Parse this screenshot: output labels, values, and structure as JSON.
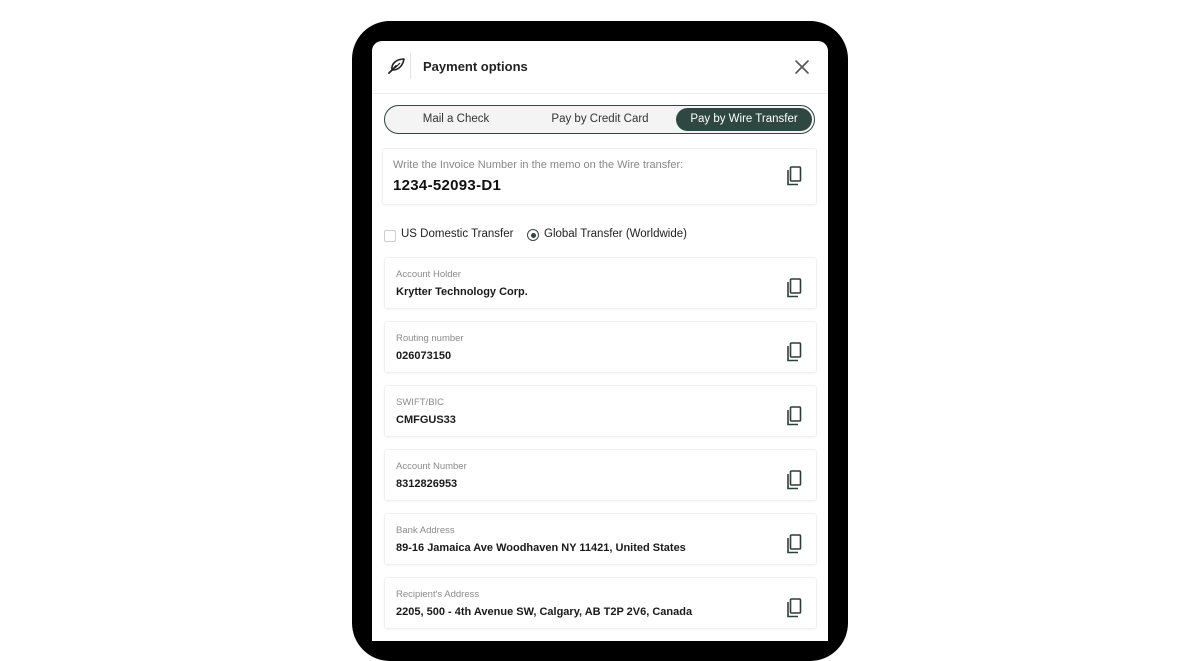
{
  "header": {
    "title": "Payment options",
    "logo_icon": "leaf-icon",
    "close_icon": "close-icon"
  },
  "tabs": [
    {
      "label": "Mail a Check",
      "active": false
    },
    {
      "label": "Pay by Credit Card",
      "active": false
    },
    {
      "label": "Pay by Wire Transfer",
      "active": true
    }
  ],
  "memo": {
    "label": "Write the Invoice Number in the memo on the Wire transfer:",
    "value": "1234-52093-D1"
  },
  "transfer_type": {
    "options": [
      {
        "label": "US Domestic Transfer",
        "selected": false
      },
      {
        "label": "Global Transfer (Worldwide)",
        "selected": true
      }
    ]
  },
  "fields": [
    {
      "label": "Account Holder",
      "value": "Krytter Technology Corp."
    },
    {
      "label": "Routing number",
      "value": "026073150"
    },
    {
      "label": "SWIFT/BIC",
      "value": "CMFGUS33"
    },
    {
      "label": "Account Number",
      "value": "8312826953"
    },
    {
      "label": "Bank Address",
      "value": "89-16 Jamaica Ave Woodhaven NY 11421, United States"
    },
    {
      "label": "Recipient's Address",
      "value": "2205, 500 - 4th Avenue SW, Calgary, AB T2P 2V6, Canada"
    }
  ],
  "colors": {
    "accent": "#2e4841",
    "frame": "#000000",
    "background": "#ffffff"
  }
}
